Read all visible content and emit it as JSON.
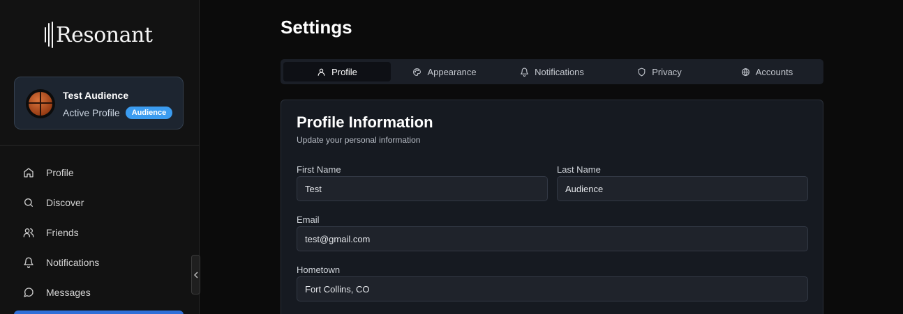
{
  "app": {
    "logo_text": "Resonant"
  },
  "profile": {
    "name": "Test Audience",
    "subtitle": "Active Profile",
    "badge": "Audience"
  },
  "nav": {
    "items": [
      {
        "label": "Profile",
        "icon": "home-icon"
      },
      {
        "label": "Discover",
        "icon": "search-icon"
      },
      {
        "label": "Friends",
        "icon": "users-icon"
      },
      {
        "label": "Notifications",
        "icon": "bell-icon"
      },
      {
        "label": "Messages",
        "icon": "message-icon"
      }
    ]
  },
  "page": {
    "title": "Settings"
  },
  "tabs": [
    {
      "label": "Profile",
      "icon": "user-icon",
      "active": true
    },
    {
      "label": "Appearance",
      "icon": "palette-icon",
      "active": false
    },
    {
      "label": "Notifications",
      "icon": "bell-icon",
      "active": false
    },
    {
      "label": "Privacy",
      "icon": "shield-icon",
      "active": false
    },
    {
      "label": "Accounts",
      "icon": "globe-icon",
      "active": false
    }
  ],
  "form": {
    "title": "Profile Information",
    "subtitle": "Update your personal information",
    "first_name": {
      "label": "First Name",
      "value": "Test"
    },
    "last_name": {
      "label": "Last Name",
      "value": "Audience"
    },
    "email": {
      "label": "Email",
      "value": "test@gmail.com"
    },
    "hometown": {
      "label": "Hometown",
      "value": "Fort Collins, CO"
    }
  },
  "colors": {
    "accent": "#3b9cf0",
    "active_nav": "#2f6fd8",
    "background": "#0b0b0b",
    "sidebar": "#121212",
    "card": "#161a21"
  }
}
